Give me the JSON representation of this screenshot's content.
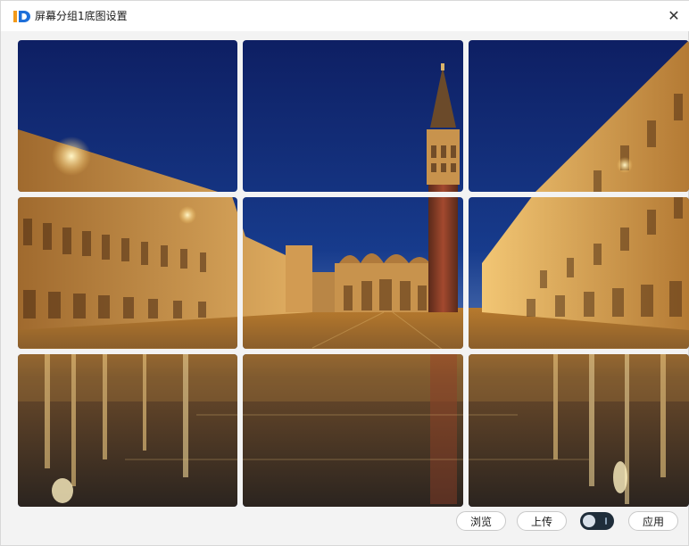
{
  "window": {
    "title": "屏幕分组1底图设置",
    "close_glyph": "✕"
  },
  "icons": {
    "app_logo": "id-logo-icon",
    "close": "close-icon"
  },
  "preview": {
    "grid_rows": 3,
    "grid_cols": 3,
    "tile_count": 9,
    "image_description_name": "night-piazza-background-image"
  },
  "toolbar": {
    "browse_label": "浏览",
    "upload_label": "上传",
    "toggle_state": "off",
    "apply_label": "应用"
  },
  "colors": {
    "logo_orange": "#f39a1a",
    "logo_blue": "#1e6fd9",
    "toggle_bg": "#1f2d3a"
  }
}
